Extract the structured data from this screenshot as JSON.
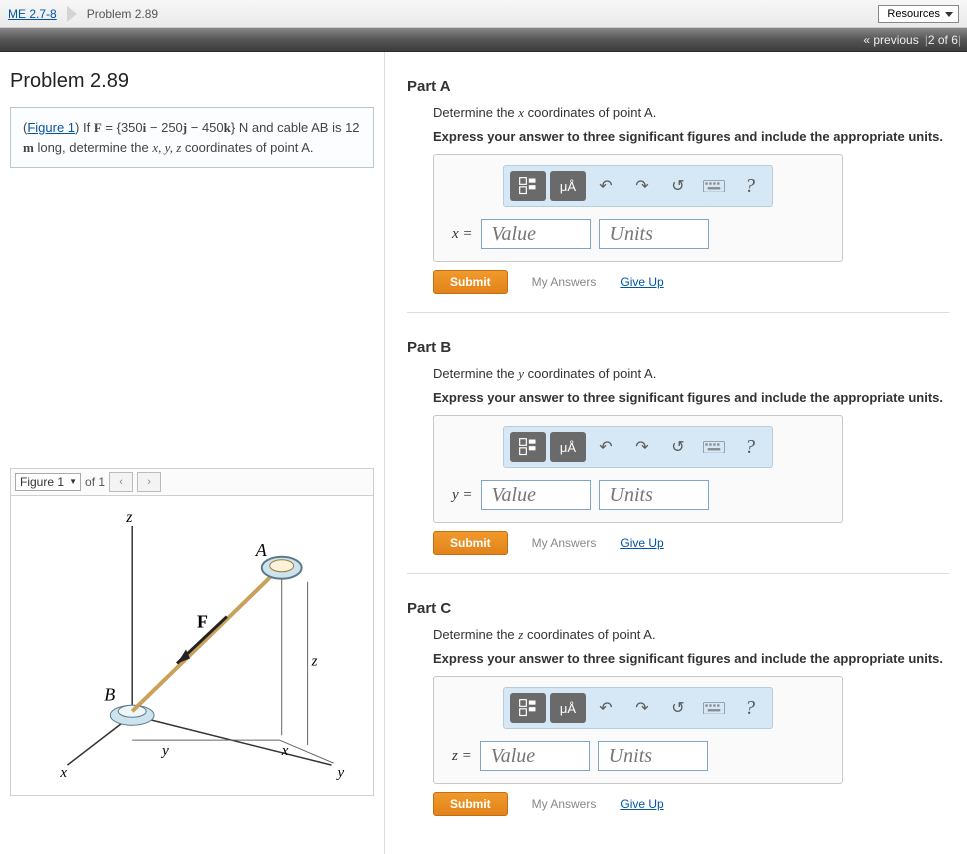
{
  "breadcrumb": {
    "course": "ME 2.7-8",
    "current": "Problem 2.89",
    "resources": "Resources"
  },
  "nav": {
    "prev": "« previous",
    "pos": "2 of 6"
  },
  "problem": {
    "title": "Problem 2.89",
    "figure_link": "Figure 1",
    "text_prefix": "If ",
    "vector": "F",
    "eq": " = {350",
    "i": "i",
    "eq2": "  −  250",
    "j": "j",
    "eq3": "  −  450",
    "k": "k",
    "eq4": "} N",
    "text_rest": " and cable AB is 12 ",
    "m": "m",
    "text_rest2": " long, determine the ",
    "xyz": "x, y, z",
    "text_rest3": " coordinates of point A."
  },
  "figure": {
    "selected": "Figure 1",
    "of": "of 1",
    "labels": {
      "A": "A",
      "B": "B",
      "F": "F",
      "x": "x",
      "y": "y",
      "z": "z",
      "xneg": "x",
      "yneg": "y"
    }
  },
  "parts": [
    {
      "label": "Part A",
      "instruction_pre": "Determine the ",
      "instruction_var": "x",
      "instruction_post": " coordinates of point A.",
      "bold": "Express your answer to three significant figures and include the appropriate units.",
      "var": "x =",
      "value_ph": "Value",
      "units_ph": "Units",
      "submit": "Submit",
      "myanswers": "My Answers",
      "giveup": "Give Up",
      "mu": "μÅ"
    },
    {
      "label": "Part B",
      "instruction_pre": "Determine the ",
      "instruction_var": "y",
      "instruction_post": " coordinates of point A.",
      "bold": "Express your answer to three significant figures and include the appropriate units.",
      "var": "y =",
      "value_ph": "Value",
      "units_ph": "Units",
      "submit": "Submit",
      "myanswers": "My Answers",
      "giveup": "Give Up",
      "mu": "μÅ"
    },
    {
      "label": "Part C",
      "instruction_pre": "Determine the ",
      "instruction_var": "z",
      "instruction_post": " coordinates of point A.",
      "bold": "Express your answer to three significant figures and include the appropriate units.",
      "var": "z =",
      "value_ph": "Value",
      "units_ph": "Units",
      "submit": "Submit",
      "myanswers": "My Answers",
      "giveup": "Give Up",
      "mu": "μÅ"
    }
  ]
}
